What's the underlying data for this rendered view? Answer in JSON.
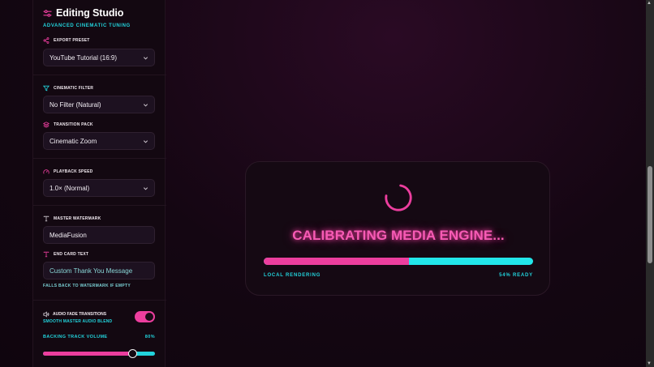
{
  "sidebar": {
    "title": "Editing Studio",
    "subtitle": "ADVANCED CINEMATIC TUNING",
    "export_preset": {
      "label": "EXPORT PRESET",
      "value": "YouTube Tutorial (16:9)"
    },
    "cinematic_filter": {
      "label": "CINEMATIC FILTER",
      "value": "No Filter (Natural)"
    },
    "transition_pack": {
      "label": "TRANSITION PACK",
      "value": "Cinematic Zoom"
    },
    "playback_speed": {
      "label": "PLAYBACK SPEED",
      "value": "1.0× (Normal)"
    },
    "master_watermark": {
      "label": "MASTER WATERMARK",
      "value": "MediaFusion"
    },
    "end_card_text": {
      "label": "END CARD TEXT",
      "placeholder": "Custom Thank You Message",
      "hint": "FALLS BACK TO WATERMARK IF EMPTY"
    },
    "audio_fade": {
      "label": "AUDIO FADE TRANSITIONS",
      "sublabel": "SMOOTH MASTER AUDIO BLEND",
      "enabled": true
    },
    "backing_volume": {
      "label": "BACKING TRACK VOLUME",
      "value_text": "80%",
      "value": 0.8
    }
  },
  "loader": {
    "title": "CALIBRATING MEDIA ENGINE...",
    "left_label": "LOCAL RENDERING",
    "right_label": "54% READY",
    "progress": 0.54
  },
  "colors": {
    "pink": "#ec3e9e",
    "cyan": "#22d3dc",
    "bg": "#140612"
  },
  "icons": [
    "sliders-icon",
    "share-icon",
    "filter-icon",
    "layers-icon",
    "gauge-icon",
    "text-icon",
    "volume-icon",
    "chevron-down-icon"
  ]
}
